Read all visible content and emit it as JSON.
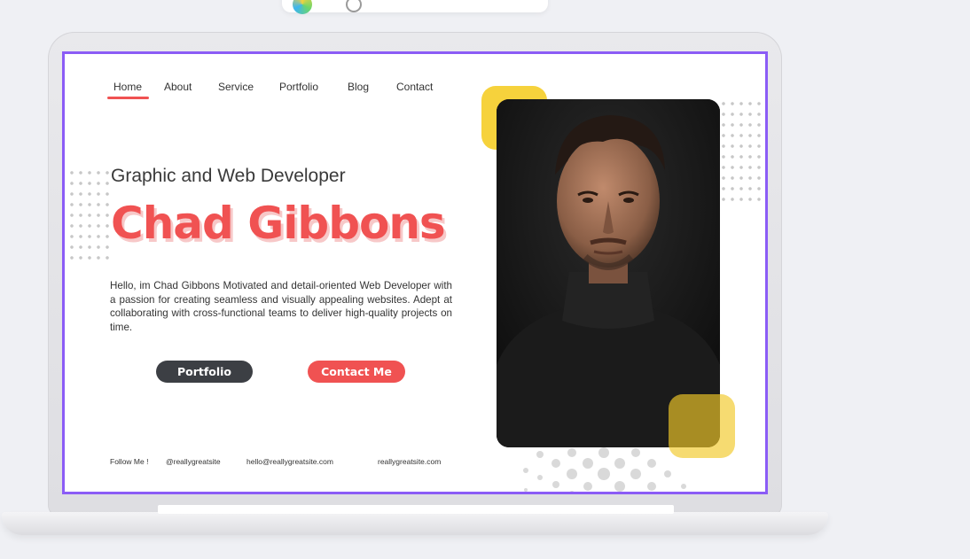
{
  "nav": {
    "items": [
      {
        "label": "Home",
        "active": true
      },
      {
        "label": "About"
      },
      {
        "label": "Service"
      },
      {
        "label": "Portfolio"
      },
      {
        "label": "Blog"
      },
      {
        "label": "Contact"
      }
    ]
  },
  "hero": {
    "subtitle": "Graphic and Web Developer",
    "name": "Chad Gibbons",
    "bio": "Hello, im Chad Gibbons Motivated and detail-oriented Web Developer with a passion for creating seamless and visually appealing websites. Adept at collaborating with cross-functional teams to deliver high-quality projects on time."
  },
  "buttons": {
    "portfolio": "Portfolio",
    "contact": "Contact Me"
  },
  "footer": {
    "follow": "Follow Me !",
    "handle": "@reallygreatsite",
    "email": "hello@reallygreatsite.com",
    "website": "reallygreatsite.com"
  },
  "colors": {
    "accent": "#f05252",
    "yellow": "#f6d23c",
    "dark_button": "#3c3f44",
    "screen_border": "#8b5cf6",
    "background": "#eff0f4"
  }
}
